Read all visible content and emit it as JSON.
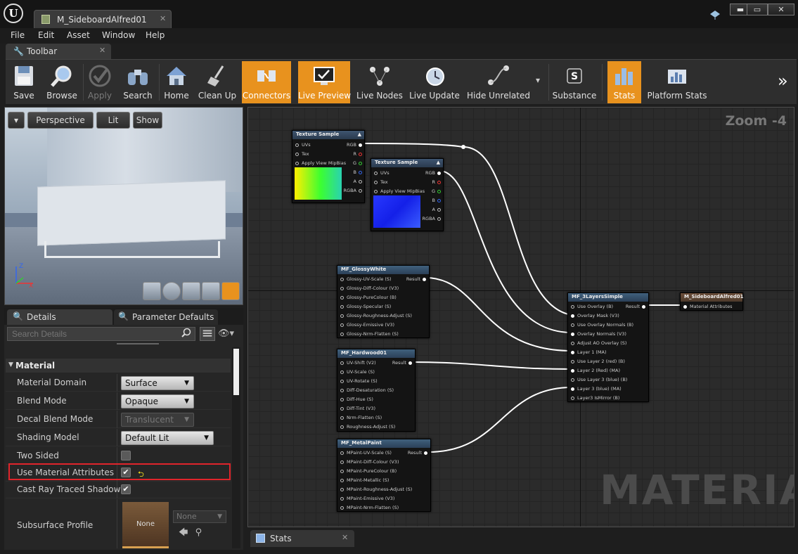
{
  "window": {
    "document_tab": "M_SideboardAlfred01",
    "close_glyph": "✕",
    "minimize_glyph": "▬",
    "maximize_glyph": "▭",
    "window_close_glyph": "✕"
  },
  "menu": [
    "File",
    "Edit",
    "Asset",
    "Window",
    "Help"
  ],
  "toolbar_tab": {
    "label": "Toolbar",
    "close": "✕"
  },
  "toolbar": {
    "buttons": [
      {
        "label": "Save",
        "icon": "save-icon",
        "state": "normal"
      },
      {
        "label": "Browse",
        "icon": "magnifier-icon",
        "state": "normal"
      },
      {
        "label": "Apply",
        "icon": "checkmark-icon",
        "state": "disabled"
      },
      {
        "label": "Search",
        "icon": "binoculars-icon",
        "state": "normal"
      },
      {
        "label": "Home",
        "icon": "home-icon",
        "state": "normal"
      },
      {
        "label": "Clean Up",
        "icon": "broom-icon",
        "state": "normal"
      },
      {
        "label": "Connectors",
        "icon": "connectors-icon",
        "state": "active"
      },
      {
        "label": "Live Preview",
        "icon": "monitor-icon",
        "state": "active"
      },
      {
        "label": "Live Nodes",
        "icon": "nodes-icon",
        "state": "normal"
      },
      {
        "label": "Live Update",
        "icon": "clock-icon",
        "state": "normal"
      },
      {
        "label": "Hide Unrelated",
        "icon": "graph-icon",
        "state": "normal"
      },
      {
        "label": "Substance",
        "icon": "substance-icon",
        "state": "normal"
      },
      {
        "label": "Stats",
        "icon": "bar-chart-icon",
        "state": "active"
      },
      {
        "label": "Platform Stats",
        "icon": "platform-stats-icon",
        "state": "normal"
      }
    ],
    "overflow_glyph": "»",
    "dropdown_glyph": "▾"
  },
  "viewport": {
    "perspective": "Perspective",
    "lit": "Lit",
    "show": "Show",
    "axis_x": "X",
    "axis_z": "Z"
  },
  "details": {
    "tabs": [
      "Details",
      "Parameter Defaults"
    ],
    "search_placeholder": "Search Details",
    "category": "Material",
    "properties": [
      {
        "name": "Material Domain",
        "type": "combo",
        "value": "Surface"
      },
      {
        "name": "Blend Mode",
        "type": "combo",
        "value": "Opaque"
      },
      {
        "name": "Decal Blend Mode",
        "type": "combo-disabled",
        "value": "Translucent"
      },
      {
        "name": "Shading Model",
        "type": "combo",
        "value": "Default Lit"
      },
      {
        "name": "Two Sided",
        "type": "check",
        "checked": false
      },
      {
        "name": "Use Material Attributes",
        "type": "check",
        "checked": true
      },
      {
        "name": "Cast Ray Traced Shadows",
        "type": "check",
        "checked": true
      },
      {
        "name": "Subsurface Profile",
        "type": "asset"
      }
    ],
    "subsurface_thumb": "None",
    "subsurface_value": "None",
    "check_glyph": "✔",
    "reset_glyph": "⮌"
  },
  "graph": {
    "zoom": "Zoom -4",
    "watermark": "MATERIAL",
    "nodes": {
      "tex1": {
        "title": "Texture Sample",
        "inputs": [
          "UVs",
          "Tex",
          "Apply View MipBias"
        ],
        "outputs": [
          "RGB",
          "R",
          "G",
          "B",
          "A",
          "RGBA"
        ]
      },
      "tex2": {
        "title": "Texture Sample",
        "inputs": [
          "UVs",
          "Tex",
          "Apply View MipBias"
        ],
        "outputs": [
          "RGB",
          "R",
          "G",
          "B",
          "A",
          "RGBA"
        ]
      },
      "glossy": {
        "title": "MF_GlossyWhite",
        "output": "Result",
        "inputs": [
          "Glossy-UV-Scale (S)",
          "Glossy-Diff-Colour (V3)",
          "Glossy-PureColour (B)",
          "Glossy-Specular (S)",
          "Glossy-Roughness-Adjust (S)",
          "Glossy-Emissive (V3)",
          "Glossy-Nrm-Flatten (S)"
        ]
      },
      "hardwood": {
        "title": "MF_Hardwood01",
        "output": "Result",
        "inputs": [
          "UV-Shift (V2)",
          "UV-Scale (S)",
          "UV-Rotate (S)",
          "Diff-Desaturation (S)",
          "Diff-Hue (S)",
          "Diff-Tint (V3)",
          "Nrm-Flatten (S)",
          "Roughness-Adjust (S)"
        ]
      },
      "metal": {
        "title": "MF_MetalPaint",
        "output": "Result",
        "inputs": [
          "MPaint-UV-Scale (S)",
          "MPaint-Diff-Colour (V3)",
          "MPaint-PureColour (B)",
          "MPaint-Metallic (S)",
          "MPaint-Roughness-Adjust (S)",
          "MPaint-Emissive (V3)",
          "MPaint-Nrm-Flatten (S)"
        ]
      },
      "layers": {
        "title": "MF_3LayersSimple",
        "output": "Result",
        "inputs": [
          "Use Overlay (B)",
          "Overlay Mask (V3)",
          "Use Overlay Normals (B)",
          "Overlay Normals (V3)",
          "Adjust AO Overlay (S)",
          "Layer 1 (MA)",
          "Use Layer 2 (red) (B)",
          "Layer 2 (Red) (MA)",
          "Use Layer 3 (blue) (B)",
          "Layer 3 (blue) (MA)",
          "Layer3 IsMirror (B)"
        ]
      },
      "result": {
        "title": "M_SideboardAlfred01",
        "inputs": [
          "Material Attributes"
        ]
      }
    }
  },
  "bottom_tab": {
    "label": "Stats",
    "close": "✕"
  },
  "colors": {
    "accent": "#e8921e",
    "highlight": "#e0242b",
    "bg": "#1e1e1e"
  }
}
